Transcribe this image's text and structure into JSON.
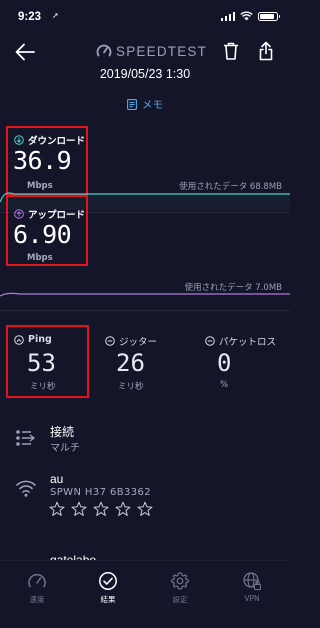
{
  "status_bar": {
    "time": "9:23",
    "location_arrow": "➚"
  },
  "header": {
    "logo_text": "SPEEDTEST",
    "datetime": "2019/05/23 1:30",
    "memo_label": "メモ"
  },
  "download": {
    "label": "ダウンロード",
    "value": "36.9",
    "unit": "Mbps",
    "usage": "使用されたデータ 68.8MB"
  },
  "upload": {
    "label": "アップロード",
    "value": "6.90",
    "unit": "Mbps",
    "usage": "使用されたデータ 7.0MB"
  },
  "ping": {
    "label": "Ping",
    "value": "53",
    "unit": "ミリ秒"
  },
  "jitter": {
    "label": "ジッター",
    "value": "26",
    "unit": "ミリ秒"
  },
  "packet_loss": {
    "label": "パケットロス",
    "value": "0",
    "unit": "%"
  },
  "connection": {
    "title": "接続",
    "subtitle": "マルチ"
  },
  "provider": {
    "title": "au",
    "subtitle": "SPWN  H37  6B3362",
    "rating_stars": 0,
    "rating_max": 5
  },
  "server": {
    "title": "gatelabo"
  },
  "nav": {
    "items": [
      {
        "label": "速度",
        "icon": "speedometer-icon",
        "active": false
      },
      {
        "label": "結果",
        "icon": "check-circle-icon",
        "active": true
      },
      {
        "label": "設定",
        "icon": "gear-icon",
        "active": false
      },
      {
        "label": "VPN",
        "icon": "globe-lock-icon",
        "active": false
      }
    ]
  },
  "colors": {
    "background": "#141528",
    "accent_blue": "#4fa8e8",
    "download_line": "#4fd1c5",
    "upload_line": "#b07ae0",
    "highlight_red": "#e0141b"
  }
}
